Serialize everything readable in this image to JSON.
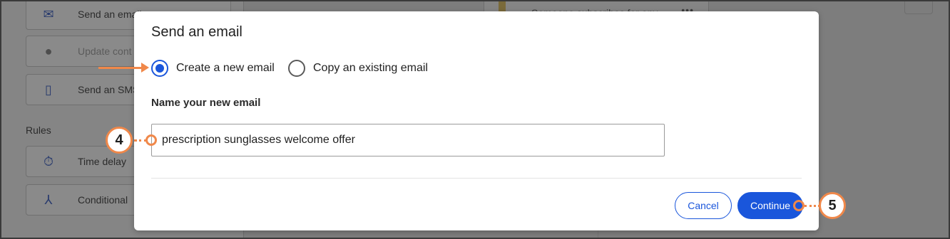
{
  "background": {
    "action_cards": [
      {
        "label": "Send an email",
        "icon": "mail-icon",
        "muted": false
      },
      {
        "label": "Update cont",
        "icon": "person-icon",
        "muted": true
      },
      {
        "label": "Send an SMS",
        "icon": "phone-icon",
        "muted": false
      }
    ],
    "rules_heading": "Rules",
    "rule_cards": [
      {
        "label": "Time delay",
        "icon": "stopwatch-icon"
      },
      {
        "label": "Conditional",
        "icon": "branch-icon"
      }
    ],
    "trigger_card_text": "Someone subscribes for any",
    "trigger_card_menu": "•••"
  },
  "modal": {
    "title": "Send an email",
    "options": [
      {
        "label": "Create a new email",
        "checked": true
      },
      {
        "label": "Copy an existing email",
        "checked": false
      }
    ],
    "name_label": "Name your new email",
    "name_value": "prescription sunglasses welcome offer",
    "cancel_label": "Cancel",
    "continue_label": "Continue"
  },
  "annotations": {
    "step_4": "4",
    "step_5": "5"
  },
  "colors": {
    "accent": "#1a56db",
    "callout": "#f0884a",
    "overlay": "#7d7d7d"
  }
}
